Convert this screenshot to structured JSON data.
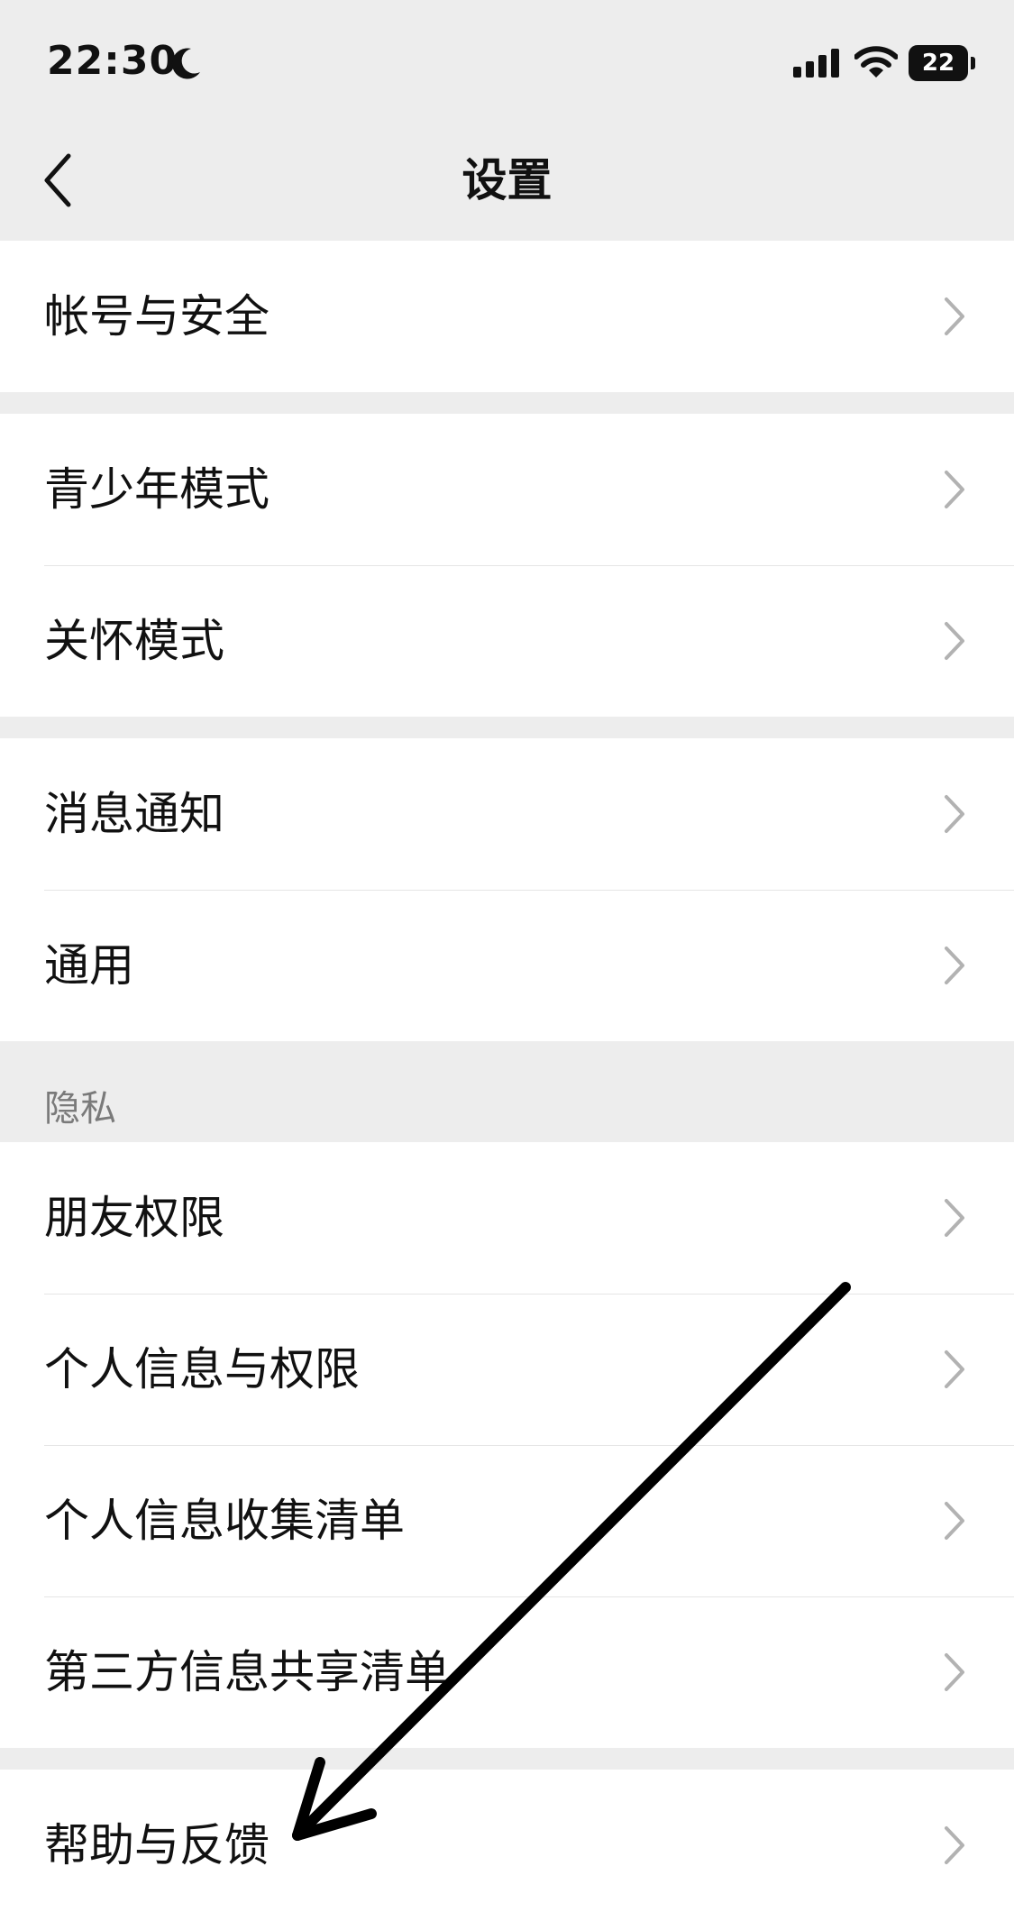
{
  "status": {
    "time": "22:30",
    "battery": "22"
  },
  "header": {
    "title": "设置"
  },
  "groups": [
    {
      "items": [
        {
          "label": "帐号与安全"
        }
      ]
    },
    {
      "items": [
        {
          "label": "青少年模式"
        },
        {
          "label": "关怀模式"
        }
      ]
    },
    {
      "items": [
        {
          "label": "消息通知"
        },
        {
          "label": "通用"
        }
      ]
    },
    {
      "title": "隐私",
      "items": [
        {
          "label": "朋友权限"
        },
        {
          "label": "个人信息与权限"
        },
        {
          "label": "个人信息收集清单"
        },
        {
          "label": "第三方信息共享清单"
        }
      ]
    },
    {
      "items": [
        {
          "label": "帮助与反馈"
        }
      ]
    }
  ],
  "icons": {
    "back": "chevron-left-icon",
    "row_chevron": "chevron-right-icon",
    "moon": "moon-icon",
    "signal": "signal-icon",
    "wifi": "wifi-icon",
    "battery": "battery-icon"
  },
  "colors": {
    "background": "#ededed",
    "card": "#ffffff",
    "annotation": "#000000"
  }
}
